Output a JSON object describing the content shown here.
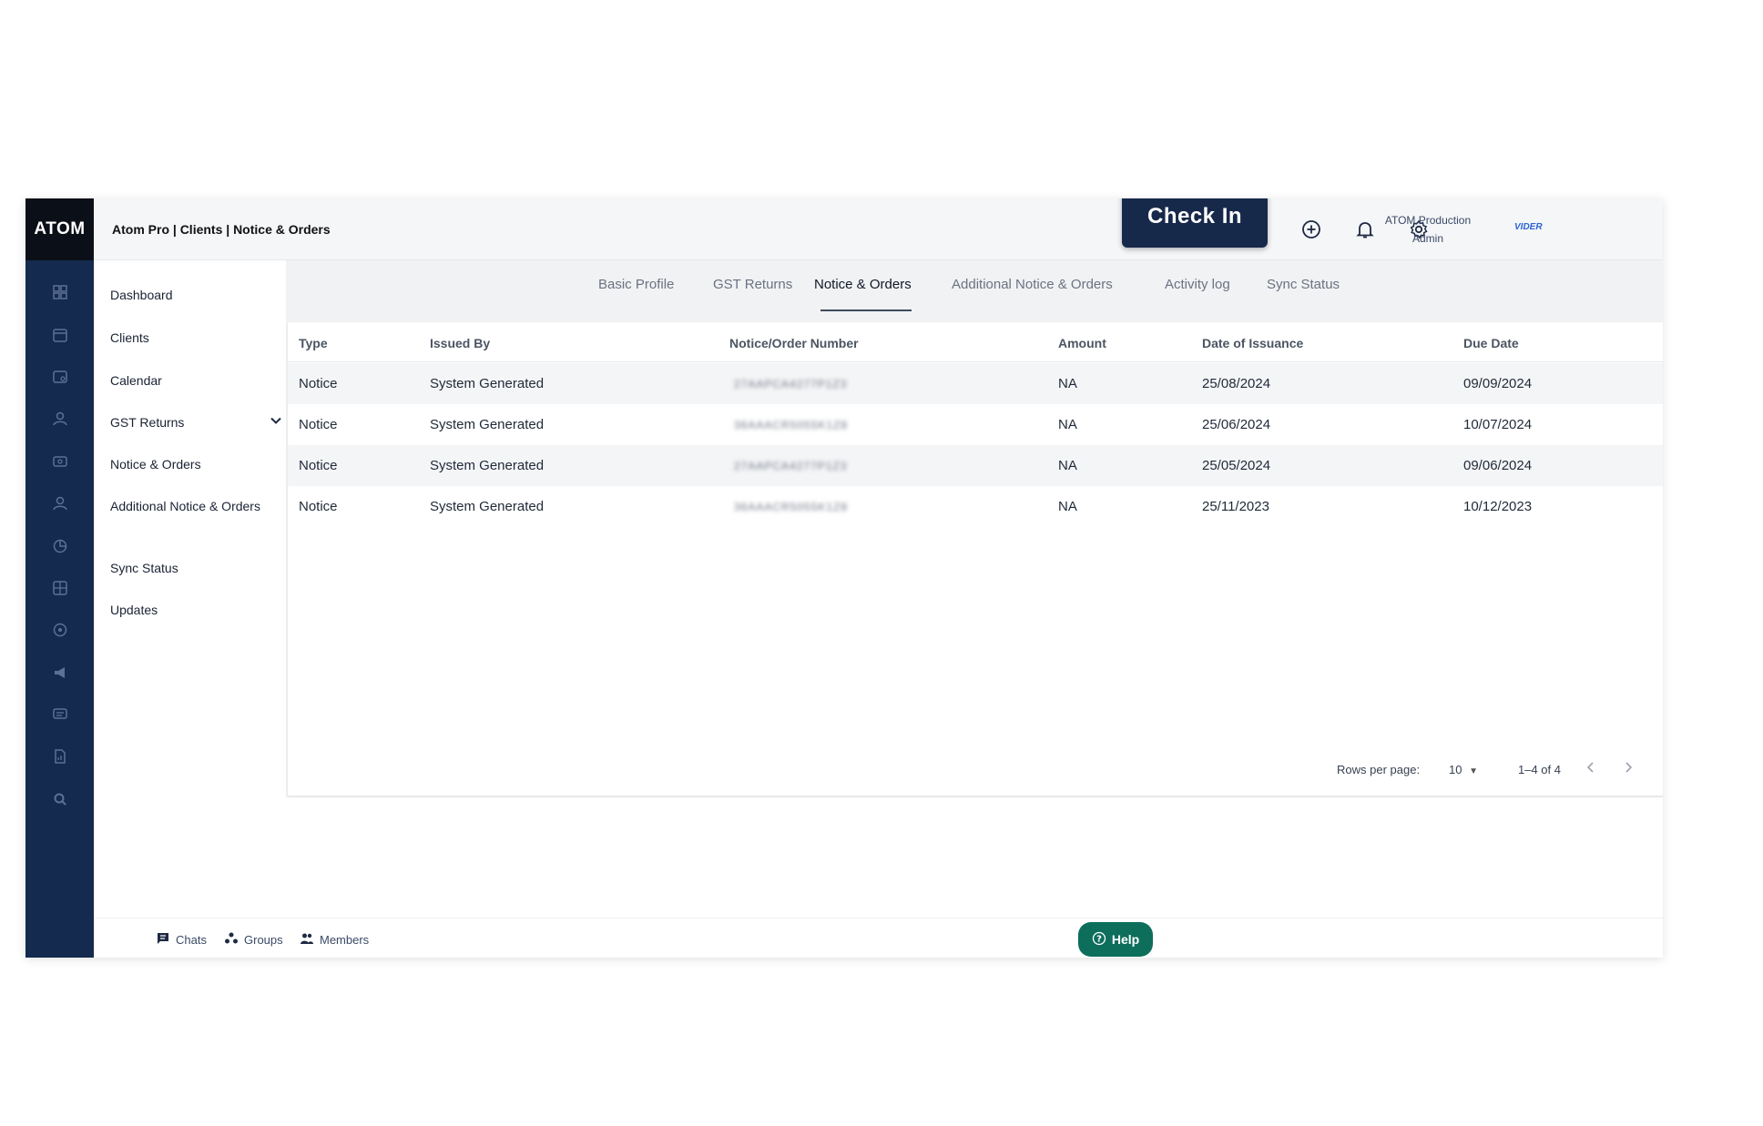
{
  "app": {
    "logo": "ATOM"
  },
  "header": {
    "breadcrumb": "Atom Pro | Clients | Notice & Orders",
    "check_in_label": "Check In",
    "user_name": "ATOM Production",
    "user_role": "Admin",
    "brand": "VIDER"
  },
  "rail_icons": [
    "dashboard-icon",
    "calendar-icon",
    "clients-icon",
    "user-icon",
    "billing-icon",
    "profile-icon",
    "analytics-icon",
    "grid-icon",
    "report-icon",
    "megaphone-icon",
    "messages-icon",
    "document-icon",
    "search-icon"
  ],
  "sidebar": {
    "items": [
      {
        "label": "Dashboard"
      },
      {
        "label": "Clients"
      },
      {
        "label": "Calendar"
      },
      {
        "label": "GST Returns"
      },
      {
        "label": "Notice & Orders"
      },
      {
        "label": "Additional Notice & Orders"
      },
      {
        "label": "Sync Status"
      },
      {
        "label": "Updates"
      }
    ]
  },
  "tabs": [
    {
      "label": "Basic Profile"
    },
    {
      "label": "GST Returns"
    },
    {
      "label": "Notice & Orders",
      "active": true
    },
    {
      "label": "Additional Notice & Orders"
    },
    {
      "label": "Activity log"
    },
    {
      "label": "Sync Status"
    }
  ],
  "table": {
    "columns": [
      "Type",
      "Issued By",
      "Notice/Order Number",
      "Amount",
      "Date of Issuance",
      "Due Date"
    ],
    "rows": [
      [
        "Notice",
        "System Generated",
        "27AAPCA4277P1Z3",
        "NA",
        "25/08/2024",
        "09/09/2024"
      ],
      [
        "Notice",
        "System Generated",
        "36AAACR5055K1Z8",
        "NA",
        "25/06/2024",
        "10/07/2024"
      ],
      [
        "Notice",
        "System Generated",
        "27AAPCA4277P1Z3",
        "NA",
        "25/05/2024",
        "09/06/2024"
      ],
      [
        "Notice",
        "System Generated",
        "36AAACR5055K1Z8",
        "NA",
        "25/11/2023",
        "10/12/2023"
      ]
    ]
  },
  "pagination": {
    "rows_per_page_label": "Rows per page:",
    "rows_per_page_value": "10",
    "range": "1–4 of 4"
  },
  "footer": {
    "chats": "Chats",
    "groups": "Groups",
    "members": "Members",
    "help": "Help"
  }
}
